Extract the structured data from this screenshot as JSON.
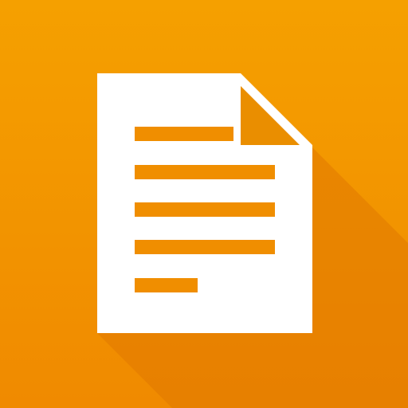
{
  "icon": {
    "name": "document-icon",
    "background_top": "#F5A000",
    "background_bottom": "#F08A00",
    "shadow_color": "#E07800",
    "page_color": "#FFFFFF",
    "fold_color": "#EA8E00",
    "line_color": "#F08E00",
    "text_lines": 5
  }
}
